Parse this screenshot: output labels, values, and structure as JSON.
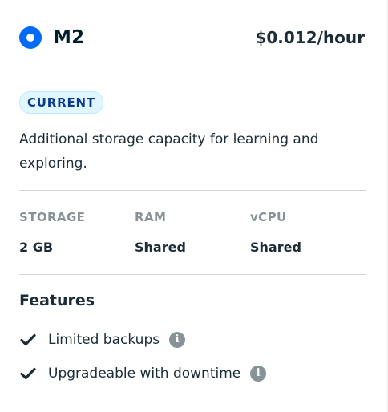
{
  "tier": {
    "name": "M2",
    "price": "$0.012/hour",
    "badge": "CURRENT",
    "description": "Additional storage capacity for learning and exploring.",
    "selected": true
  },
  "specs": [
    {
      "label": "STORAGE",
      "value": "2 GB"
    },
    {
      "label": "RAM",
      "value": "Shared"
    },
    {
      "label": "vCPU",
      "value": "Shared"
    }
  ],
  "features": {
    "title": "Features",
    "items": [
      {
        "label": "Limited backups",
        "icon": "check-icon",
        "info_icon": "info-icon"
      },
      {
        "label": "Upgradeable with downtime",
        "icon": "check-icon",
        "info_icon": "info-icon"
      }
    ]
  },
  "colors": {
    "accent": "#016bf8",
    "badge_bg": "#e1f7ff",
    "badge_text": "#0c3a8c",
    "muted": "#889397",
    "text": "#1c2d38"
  }
}
